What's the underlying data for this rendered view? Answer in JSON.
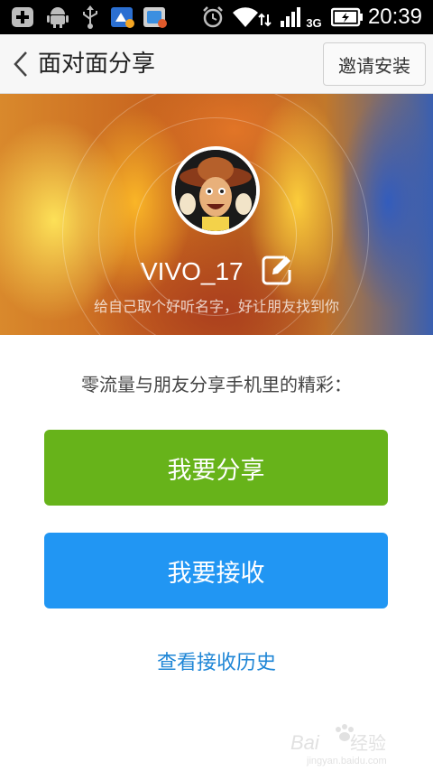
{
  "status_bar": {
    "time": "20:39",
    "network": "3G",
    "icons": [
      "add-notification-icon",
      "android-icon",
      "usb-icon",
      "app-notification-icon",
      "app-notification-icon",
      "alarm-icon",
      "wifi-icon",
      "signal-icon",
      "battery-charging-icon"
    ]
  },
  "header": {
    "title": "面对面分享",
    "invite_label": "邀请安装",
    "back_icon": "chevron-left-icon"
  },
  "profile": {
    "name": "VIVO_17",
    "hint": "给自己取个好听名字，好让朋友找到你",
    "edit_icon": "edit-icon"
  },
  "main": {
    "tagline": "零流量与朋友分享手机里的精彩：",
    "share_label": "我要分享",
    "receive_label": "我要接收",
    "history_label": "查看接收历史"
  },
  "watermark": {
    "brand": "Baidu经验",
    "url": "jingyan.baidu.com"
  },
  "colors": {
    "share_button": "#67b31a",
    "receive_button": "#2196f3",
    "link": "#1f86d6",
    "status_bar": "#000000"
  }
}
